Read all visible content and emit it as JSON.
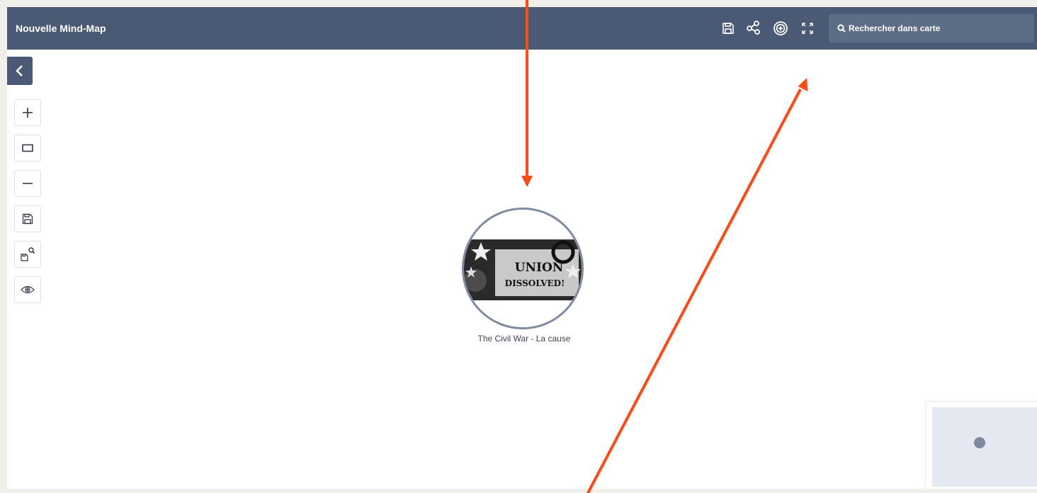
{
  "window": {
    "title": "Nouvelle Mind-Map"
  },
  "toolbar": {
    "icons": [
      "save-icon",
      "share-icon",
      "target-icon",
      "fullscreen-icon"
    ]
  },
  "search": {
    "placeholder": "Rechercher dans carte",
    "value": ""
  },
  "sidebar": {
    "collapse_icon": "chevron-left-icon",
    "tools": [
      "zoom-in-icon",
      "fit-rectangle-icon",
      "zoom-out-icon",
      "save-icon",
      "save-search-icon",
      "eye-icon"
    ]
  },
  "canvas": {
    "central_node": {
      "label": "The Civil War - La cause",
      "image_text": [
        "UNION",
        "DISSOLVED!"
      ]
    }
  },
  "colors": {
    "topbar": "#4a5a74",
    "search_bg": "#5e6d86",
    "node_border": "#7e8aa0",
    "annotation_arrow": "#ff4a14",
    "minimap_bg": "#e4e8f0"
  }
}
